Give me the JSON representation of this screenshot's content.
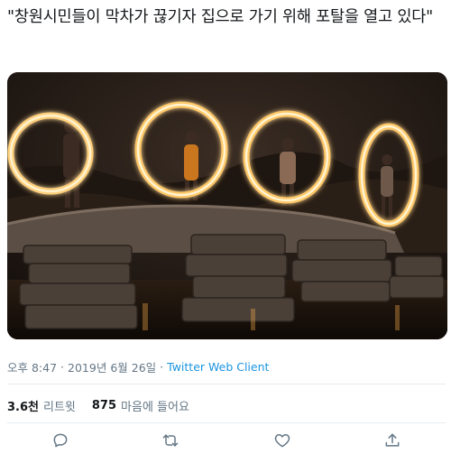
{
  "tweet": {
    "text": "\"창원시민들이 막차가 끊기자 집으로 가기 위해 포탈을 열고 있다\"",
    "photo_alt": "night photo of people spinning fire circles on a stone bridge"
  },
  "meta": {
    "time": "오후 8:47",
    "separator1": "·",
    "date": "2019년 6월 26일",
    "separator2": "·",
    "source": "Twitter Web Client"
  },
  "stats": {
    "retweets_count": "3.6천",
    "retweets_label": "리트윗",
    "likes_count": "875",
    "likes_label": "마음에 들어요"
  },
  "colors": {
    "meta_text": "#657786",
    "link": "#1b95e0",
    "divider": "#e6ecf0",
    "icon": "#657786"
  },
  "icons": {
    "reply": "reply-icon",
    "retweet": "retweet-icon",
    "like": "heart-icon",
    "share": "share-icon"
  }
}
